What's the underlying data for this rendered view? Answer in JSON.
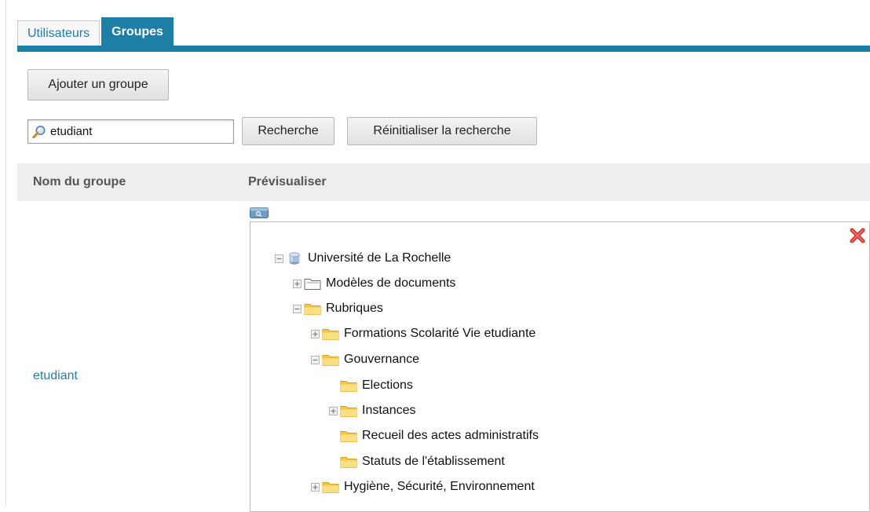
{
  "tabs": [
    {
      "label": "Utilisateurs",
      "active": false
    },
    {
      "label": "Groupes",
      "active": true
    }
  ],
  "toolbar": {
    "add_group_label": "Ajouter un groupe"
  },
  "search": {
    "value": "etudiant",
    "search_button": "Recherche",
    "reset_button": "Réinitialiser la recherche"
  },
  "table": {
    "columns": [
      "Nom du groupe",
      "Prévisualiser"
    ],
    "rows": [
      {
        "group_name": "etudiant"
      }
    ]
  },
  "tree": {
    "items": [
      {
        "label": "Université de La Rochelle",
        "icon": "database-icon",
        "toggle": "collapse"
      },
      {
        "label": "Modèles de documents",
        "icon": "folder-outline-icon",
        "toggle": "expand"
      },
      {
        "label": "Rubriques",
        "icon": "folder-icon",
        "toggle": "collapse"
      },
      {
        "label": "Formations Scolarité Vie etudiante",
        "icon": "folder-icon",
        "toggle": "expand"
      },
      {
        "label": "Gouvernance",
        "icon": "folder-icon",
        "toggle": "collapse"
      },
      {
        "label": "Elections",
        "icon": "folder-icon",
        "toggle": "none"
      },
      {
        "label": "Instances",
        "icon": "folder-icon",
        "toggle": "expand"
      },
      {
        "label": "Recueil des actes administratifs",
        "icon": "folder-icon",
        "toggle": "none"
      },
      {
        "label": "Statuts de l'établissement",
        "icon": "folder-icon",
        "toggle": "none"
      },
      {
        "label": "Hygiène, Sécurité, Environnement",
        "icon": "folder-icon",
        "toggle": "expand"
      }
    ]
  },
  "colors": {
    "accent": "#1e7fa6",
    "link": "#2a7ba4",
    "folder": "#f5c84a",
    "close": "#d9302c"
  }
}
